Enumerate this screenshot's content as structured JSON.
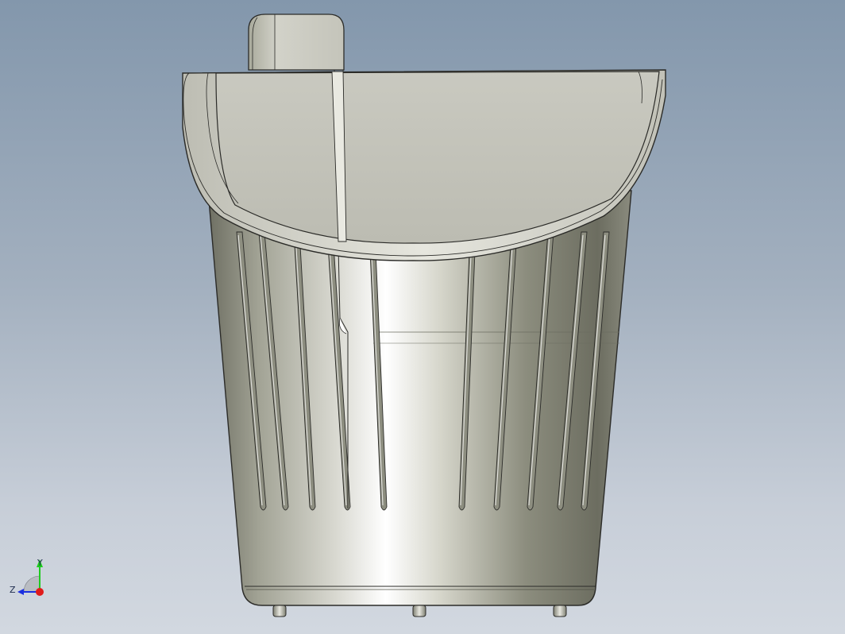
{
  "viewport": {
    "background_top": "#8397ac",
    "background_bottom": "#d2d8e0"
  },
  "model": {
    "part_color": "#c6c6bd",
    "edge_color": "#2b2b28"
  },
  "triad": {
    "y_label": "Y",
    "z_label": "Z",
    "y_color": "#1ecc1e",
    "z_color": "#1b2fe0",
    "x_color": "#e01b1b"
  }
}
